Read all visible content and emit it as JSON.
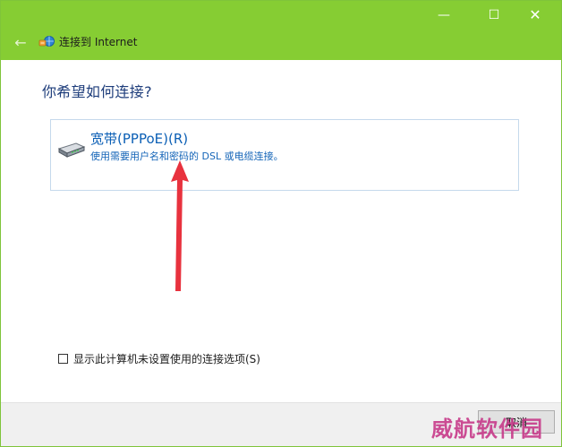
{
  "window": {
    "title": "连接到 Internet",
    "controls": {
      "minimize": "—",
      "maximize": "☐",
      "close": "✕"
    },
    "back_glyph": "←"
  },
  "main": {
    "heading": "你希望如何连接?",
    "option": {
      "title": "宽带(PPPoE)(R)",
      "description": "使用需要用户名和密码的 DSL 或电缆连接。",
      "icon": "modem-icon"
    },
    "show_unconfigured_label": "显示此计算机未设置使用的连接选项(S)",
    "show_unconfigured_checked": false
  },
  "footer": {
    "cancel_label": "取消"
  },
  "watermark": "威航软件园",
  "colors": {
    "titlebar": "#86cd33",
    "heading": "#1e3d7b",
    "link": "#0b5fb5",
    "annotation_arrow": "#e8323e",
    "watermark": "#c73a8a"
  }
}
